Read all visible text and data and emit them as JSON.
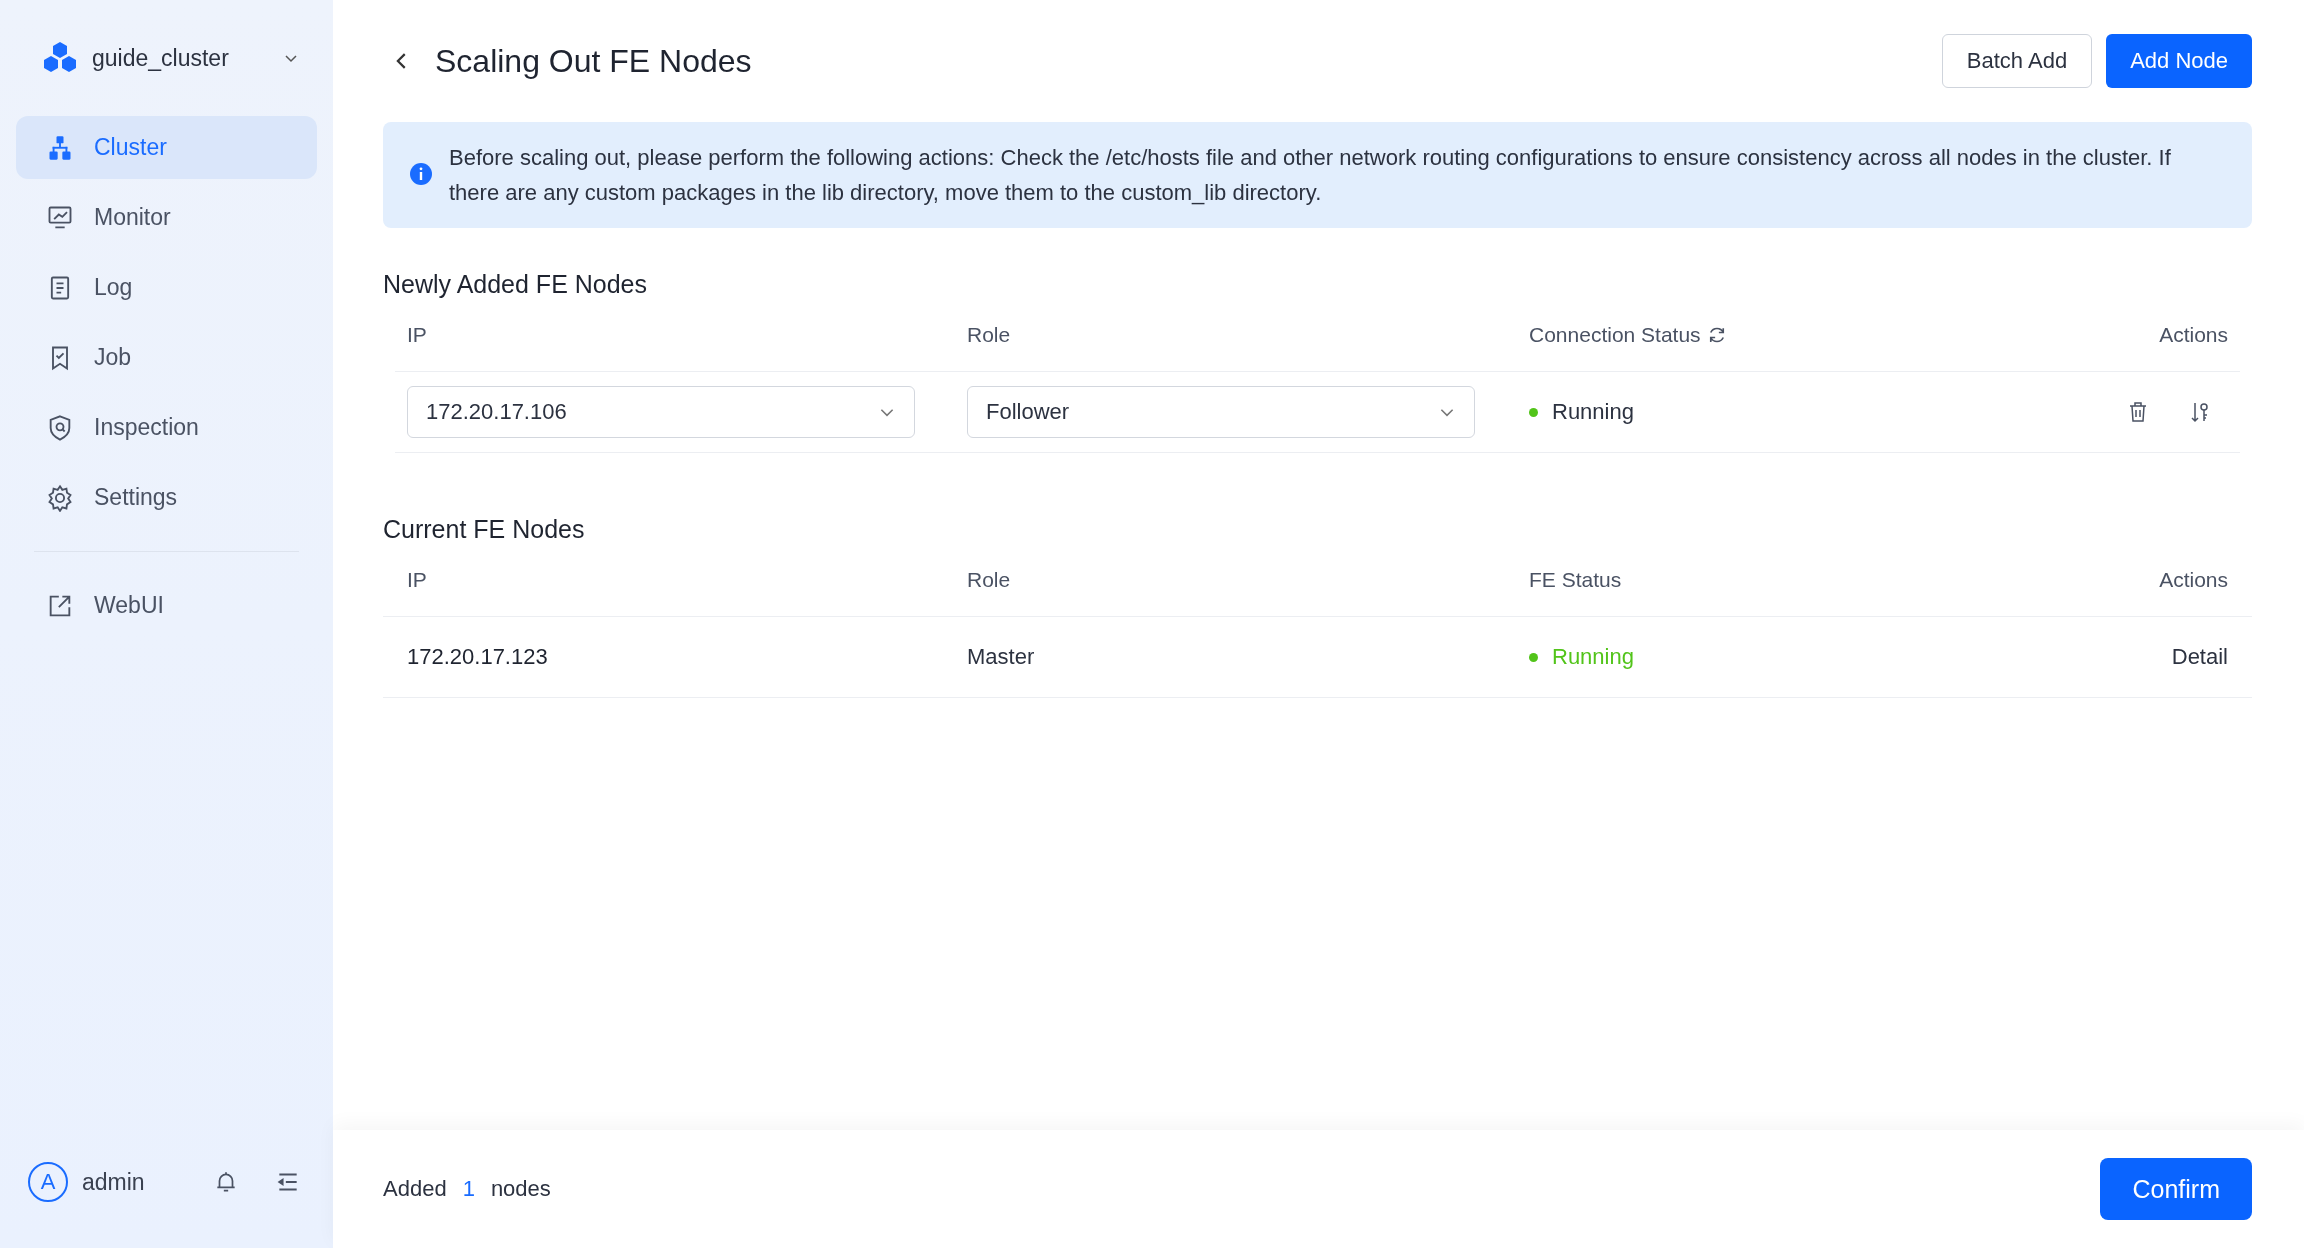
{
  "sidebar": {
    "cluster_name": "guide_cluster",
    "items": [
      {
        "label": "Cluster",
        "selected": true
      },
      {
        "label": "Monitor",
        "selected": false
      },
      {
        "label": "Log",
        "selected": false
      },
      {
        "label": "Job",
        "selected": false
      },
      {
        "label": "Inspection",
        "selected": false
      },
      {
        "label": "Settings",
        "selected": false
      }
    ],
    "links": [
      {
        "label": "WebUI"
      }
    ],
    "user": {
      "avatar": "A",
      "name": "admin"
    }
  },
  "header": {
    "title": "Scaling Out FE Nodes",
    "buttons": [
      {
        "label": "Batch Add",
        "kind": "secondary"
      },
      {
        "label": "Add Node",
        "kind": "primary"
      }
    ]
  },
  "notice": "Before scaling out, please perform the following actions: Check the /etc/hosts file and other network routing configurations to ensure consistency across all nodes in the cluster. If there are any custom packages in the lib directory, move them to the custom_lib directory.",
  "new_nodes": {
    "title": "Newly Added FE Nodes",
    "columns": [
      "IP",
      "Role",
      "Connection Status",
      "Actions"
    ],
    "rows": [
      {
        "ip": "172.20.17.106",
        "role": "Follower",
        "status": "Running",
        "color": "#52c41a"
      }
    ]
  },
  "current_nodes": {
    "title": "Current FE Nodes",
    "columns": [
      "IP",
      "Role",
      "FE Status",
      "Actions"
    ],
    "rows": [
      {
        "ip": "172.20.17.123",
        "role": "Master",
        "status": "Running",
        "color": "#52c41a",
        "action": "Detail"
      }
    ]
  },
  "footer": {
    "prefix": "Added",
    "count": "1",
    "suffix": "nodes",
    "button": "Confirm"
  }
}
